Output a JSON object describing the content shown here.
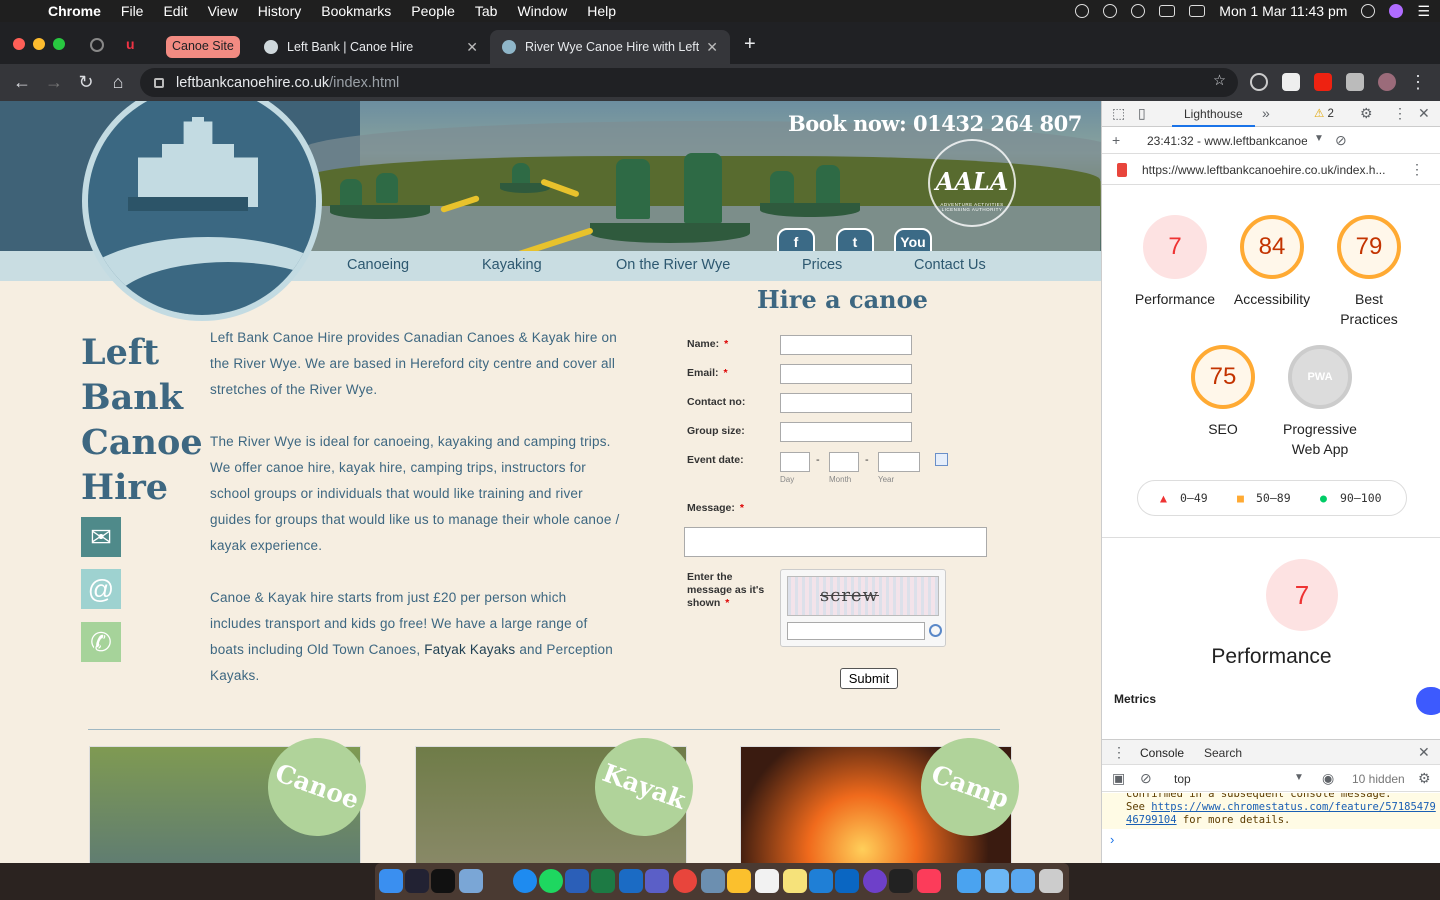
{
  "menubar": {
    "app": "Chrome",
    "items": [
      "File",
      "Edit",
      "View",
      "History",
      "Bookmarks",
      "People",
      "Tab",
      "Window",
      "Help"
    ],
    "datetime": "Mon 1 Mar  11:43 pm"
  },
  "tabs": {
    "group_label": "Canoe Site",
    "tab1": "Left Bank | Canoe Hire",
    "tab2": "River Wye Canoe Hire with Left",
    "new_tab": "+"
  },
  "toolbar": {
    "url_host": "leftbankcanoehire.co.uk",
    "url_path": "/index.html"
  },
  "site": {
    "book_now": "Book now: 01432 264 807",
    "aala_text": "AALA",
    "aala_ring": "ADVENTURE ACTIVITIES LICENSING AUTHORITY",
    "social": [
      "f",
      "t",
      "You"
    ],
    "nav": [
      "Canoeing",
      "Kayaking",
      "On the River Wye",
      "Prices",
      "Contact Us"
    ],
    "heading": "Left Bank Canoe Hire",
    "intro_p1": "Left Bank Canoe Hire provides Canadian Canoes & Kayak hire on the River Wye. We are based in Hereford city centre and cover all stretches of the River Wye.",
    "intro_p2": "The River Wye is ideal for canoeing, kayaking and camping trips. We offer canoe hire, kayak hire, camping trips, instructors for school groups or individuals that would like training and river guides for groups that would like us to manage their whole canoe / kayak experience.",
    "intro_p3a": "Canoe & Kayak hire starts from just £20 per person which includes transport and kids go free! We have a large range of boats including Old Town Canoes, ",
    "intro_p3b": "Fatyak Kayaks",
    "intro_p3c": " and Perception Kayaks.",
    "promo": [
      "Canoe",
      "Kayak",
      "Camp"
    ]
  },
  "form": {
    "title": "Hire a canoe",
    "name_label": "Name:",
    "email_label": "Email:",
    "contact_label": "Contact no:",
    "group_label": "Group size:",
    "date_label": "Event date:",
    "day": "Day",
    "month": "Month",
    "year": "Year",
    "message_label": "Message:",
    "captcha_label": "Enter the message as it's shown",
    "captcha_word": "screw",
    "required": "*",
    "dash": "-",
    "submit": "Submit"
  },
  "devtools": {
    "tab": "Lighthouse",
    "warnings": "2",
    "report": "23:41:32 - www.leftbankcanoe",
    "url": "https://www.leftbankcanoehire.co.uk/index.h...",
    "scores": [
      {
        "label": "Performance",
        "value": "7"
      },
      {
        "label": "Accessibility",
        "value": "84"
      },
      {
        "label": "Best Practices",
        "value": "79"
      },
      {
        "label": "SEO",
        "value": "75"
      },
      {
        "label": "Progressive Web App",
        "value": "PWA"
      }
    ],
    "legend": [
      "0–49",
      "50–89",
      "90–100"
    ],
    "main_score": "7",
    "main_label": "Performance",
    "metrics": "Metrics",
    "drawer_console": "Console",
    "drawer_search": "Search",
    "context": "top",
    "hidden": "10 hidden",
    "warn_line1": "confirmed in a subsequent console message.",
    "warn_see": "See ",
    "warn_link": "https://www.chromestatus.com/feature/5718547946799104",
    "warn_tail": " for more details."
  },
  "colors": {
    "site_blue": "#3d6781",
    "nav_bg": "#c9dde2",
    "page_bg": "#f6eee1",
    "promo_green": "#b0d39a",
    "score_red": "#e33",
    "score_orange": "#fa3"
  }
}
